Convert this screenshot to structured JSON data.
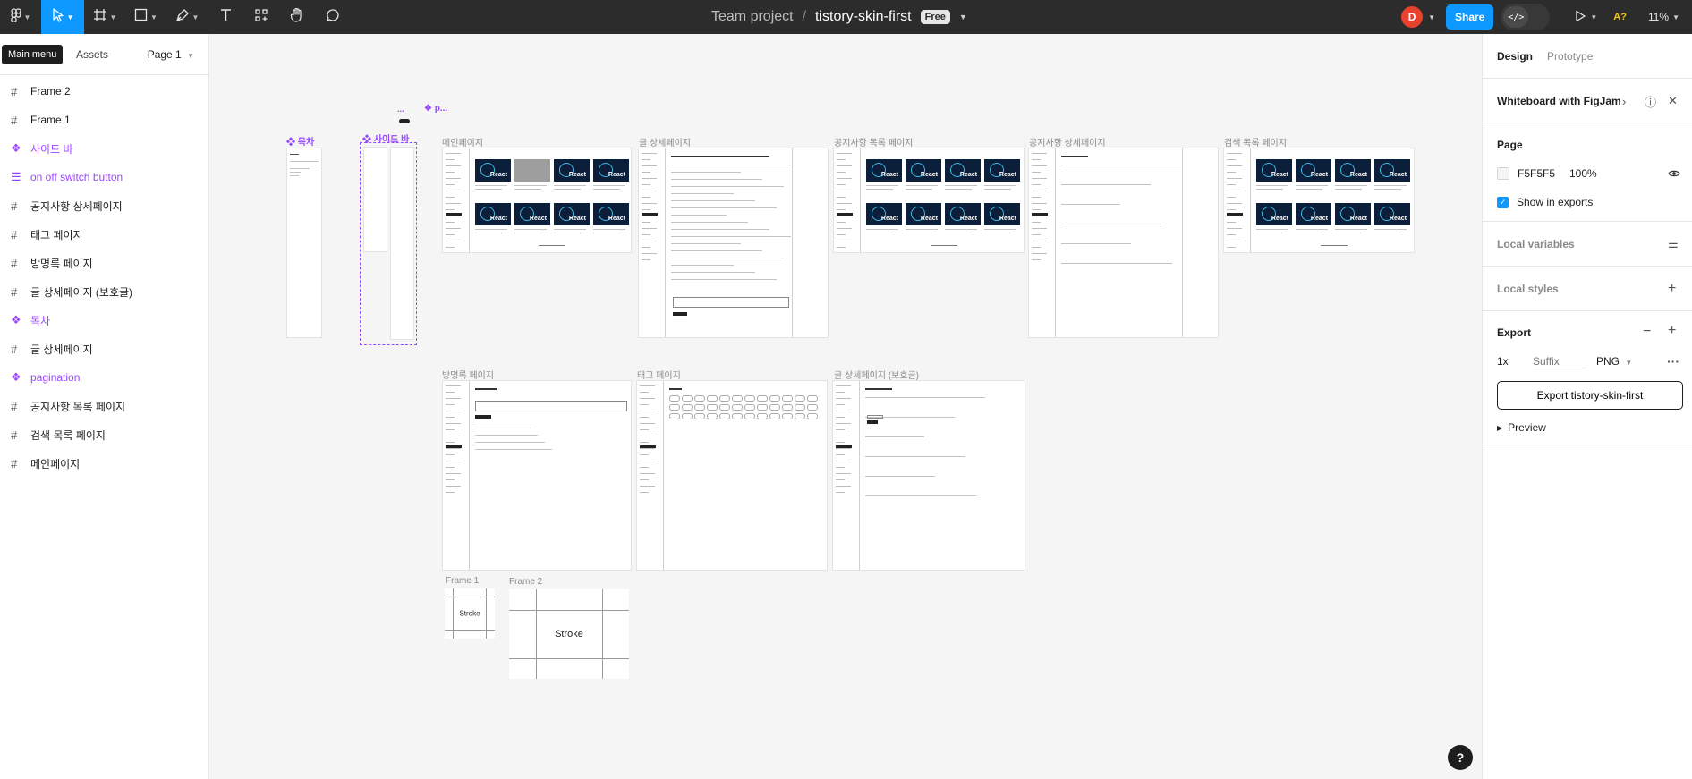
{
  "toolbar": {
    "main_menu_tooltip": "Main menu",
    "team": "Team project",
    "separator": "/",
    "file_name": "tistory-skin-first",
    "plan_badge": "Free",
    "avatar_initial": "D",
    "share_label": "Share",
    "dev_mode_label": "</>",
    "accessibility_label": "A?",
    "zoom": "11%"
  },
  "left_panel": {
    "tab_assets": "Assets",
    "page_select": "Page 1",
    "layers": [
      {
        "label": "Frame 2",
        "kind": "frame"
      },
      {
        "label": "Frame 1",
        "kind": "frame"
      },
      {
        "label": "사이드 바",
        "kind": "component"
      },
      {
        "label": "on off switch button",
        "kind": "component-set"
      },
      {
        "label": "공지사항 상세페이지",
        "kind": "frame"
      },
      {
        "label": "태그 페이지",
        "kind": "frame"
      },
      {
        "label": "방명록 페이지",
        "kind": "frame"
      },
      {
        "label": "글 상세페이지 (보호글)",
        "kind": "frame"
      },
      {
        "label": "목차",
        "kind": "component"
      },
      {
        "label": "글 상세페이지",
        "kind": "frame"
      },
      {
        "label": "pagination",
        "kind": "component"
      },
      {
        "label": "공지사항 목록 페이지",
        "kind": "frame"
      },
      {
        "label": "검색 목록 페이지",
        "kind": "frame"
      },
      {
        "label": "메인페이지",
        "kind": "frame"
      }
    ]
  },
  "canvas": {
    "labels": {
      "toc": "목차",
      "sidebar": "사이드 바",
      "dots": "...",
      "pagination_short": "p...",
      "main_page": "메인페이지",
      "post_detail": "글 상세페이지",
      "notice_list": "공지사항 목록 페이지",
      "notice_detail": "공지사항 상세페이지",
      "search_list": "검색 목록 페이지",
      "guestbook": "방명록 페이지",
      "tag_page": "태그 페이지",
      "post_protected": "글 상세페이지 (보호글)",
      "frame1": "Frame 1",
      "frame2": "Frame 2",
      "stroke": "Stroke",
      "card_text": "React"
    }
  },
  "right_panel": {
    "tab_design": "Design",
    "tab_prototype": "Prototype",
    "promo": "Whiteboard with FigJam",
    "page_section": "Page",
    "page_color": "F5F5F5",
    "page_opacity": "100%",
    "show_in_exports": "Show in exports",
    "local_variables": "Local variables",
    "local_styles": "Local styles",
    "export_section": "Export",
    "export_scale": "1x",
    "export_suffix_placeholder": "Suffix",
    "export_format": "PNG",
    "export_button": "Export tistory-skin-first",
    "preview": "Preview"
  },
  "colors": {
    "toolbar_bg": "#2c2c2c",
    "accent": "#0d99ff",
    "component": "#9747ff",
    "canvas_bg": "#f5f5f5"
  }
}
